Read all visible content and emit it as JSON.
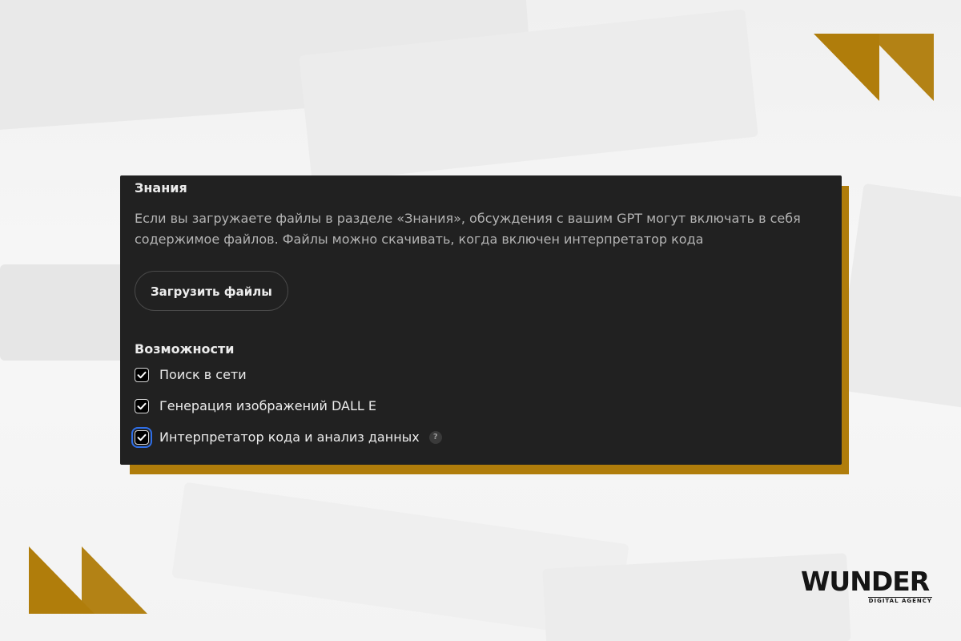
{
  "knowledge": {
    "title": "Знания",
    "description": "Если вы загружаете файлы в разделе «Знания», обсуждения с вашим GPT могут включать в себя содержимое файлов. Файлы можно скачивать, когда включен интерпретатор кода",
    "upload_button": "Загрузить файлы"
  },
  "capabilities": {
    "title": "Возможности",
    "items": [
      {
        "label": "Поиск в сети",
        "checked": true,
        "icon": "checkmark-icon"
      },
      {
        "label": "Генерация изображений DALL E",
        "checked": true,
        "icon": "checkmark-icon"
      },
      {
        "label": "Интерпретатор кода и анализ данных",
        "checked": true,
        "focused": true,
        "icon": "checkmark-icon",
        "help_icon": "?"
      }
    ]
  },
  "branding": {
    "logo_text": "WUNDER",
    "logo_subtitle": "DIGITAL AGENCY",
    "accent_color": "#b07d0b",
    "panel_color": "#212121",
    "focus_color": "#2f6fe8"
  }
}
